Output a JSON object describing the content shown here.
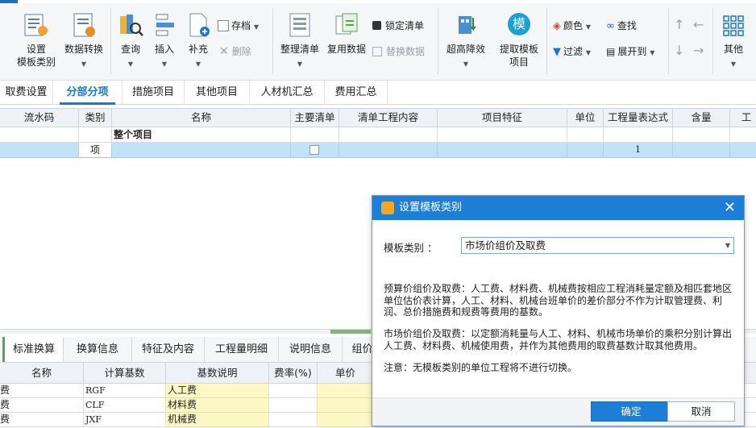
{
  "ribbon": {
    "set_template_category": "设置\n模板类别",
    "set_template_line1": "设置",
    "set_template_line2": "模板类别",
    "data_convert": "数据转换",
    "query": "查询",
    "insert": "插入",
    "supplement": "补充",
    "archive": "存档",
    "delete": "删除",
    "organize_list": "整理清单",
    "reuse_data": "复用数据",
    "lock_list": "锁定清单",
    "replace_data": "替换数据",
    "ultra_high_reduction": "超高降效",
    "extract_template": "提取模板",
    "extract_template_line2": "项目",
    "mo_glyph": "模",
    "color": "颜色",
    "find": "查找",
    "filter": "过滤",
    "expand_to": "展开到",
    "other": "其他"
  },
  "tabs": [
    "取费设置",
    "分部分项",
    "措施项目",
    "其他项目",
    "人材机汇总",
    "费用汇总"
  ],
  "active_tab": "分部分项",
  "grid": {
    "headers": [
      "流水码",
      "类别",
      "名称",
      "主要清单",
      "清单工程内容",
      "项目特征",
      "单位",
      "工程量表达式",
      "含量",
      "工"
    ],
    "row1": {
      "name": "整个项目"
    },
    "row2": {
      "category": "项",
      "quantity": "1"
    }
  },
  "lower": {
    "tabs": [
      "标准换算",
      "换算信息",
      "特征及内容",
      "工程量明细",
      "说明信息",
      "组价"
    ],
    "active_tab": "标准换算",
    "headers": [
      "名称",
      "计算基数",
      "基数说明",
      "费率(%)",
      "单价"
    ],
    "rows": [
      {
        "name": "费",
        "base": "RGF",
        "desc": "人工费"
      },
      {
        "name": "费",
        "base": "CLF",
        "desc": "材料费"
      },
      {
        "name": "费",
        "base": "JXF",
        "desc": "机械费"
      }
    ]
  },
  "dialog": {
    "title": "设置模板类别",
    "field_label": "模板类别 ：",
    "selected": "市场价组价及取费",
    "para1": "预算价组价及取费：人工费、材料费、机械费按相应工程消耗量定额及相匹套地区单位估价表计算，人工、材料、机械台班单价的差价部分不作为计取管理费、利润、总价措施费和规费等费用的基数。",
    "para2": "市场价组价及取费：以定额消耗量与人工、材料、机械市场单价的乘积分别计算出人工费、材料费、机械使用费，并作为其他费用的取费基数计取其他费用。",
    "para3": "注意：无模板类别的单位工程将不进行切换。",
    "ok": "确定",
    "cancel": "取消"
  },
  "colors": {
    "accent": "#1d7ed7",
    "selected_row": "#bfe3f7",
    "yellow_cell": "#fdf8c4"
  }
}
